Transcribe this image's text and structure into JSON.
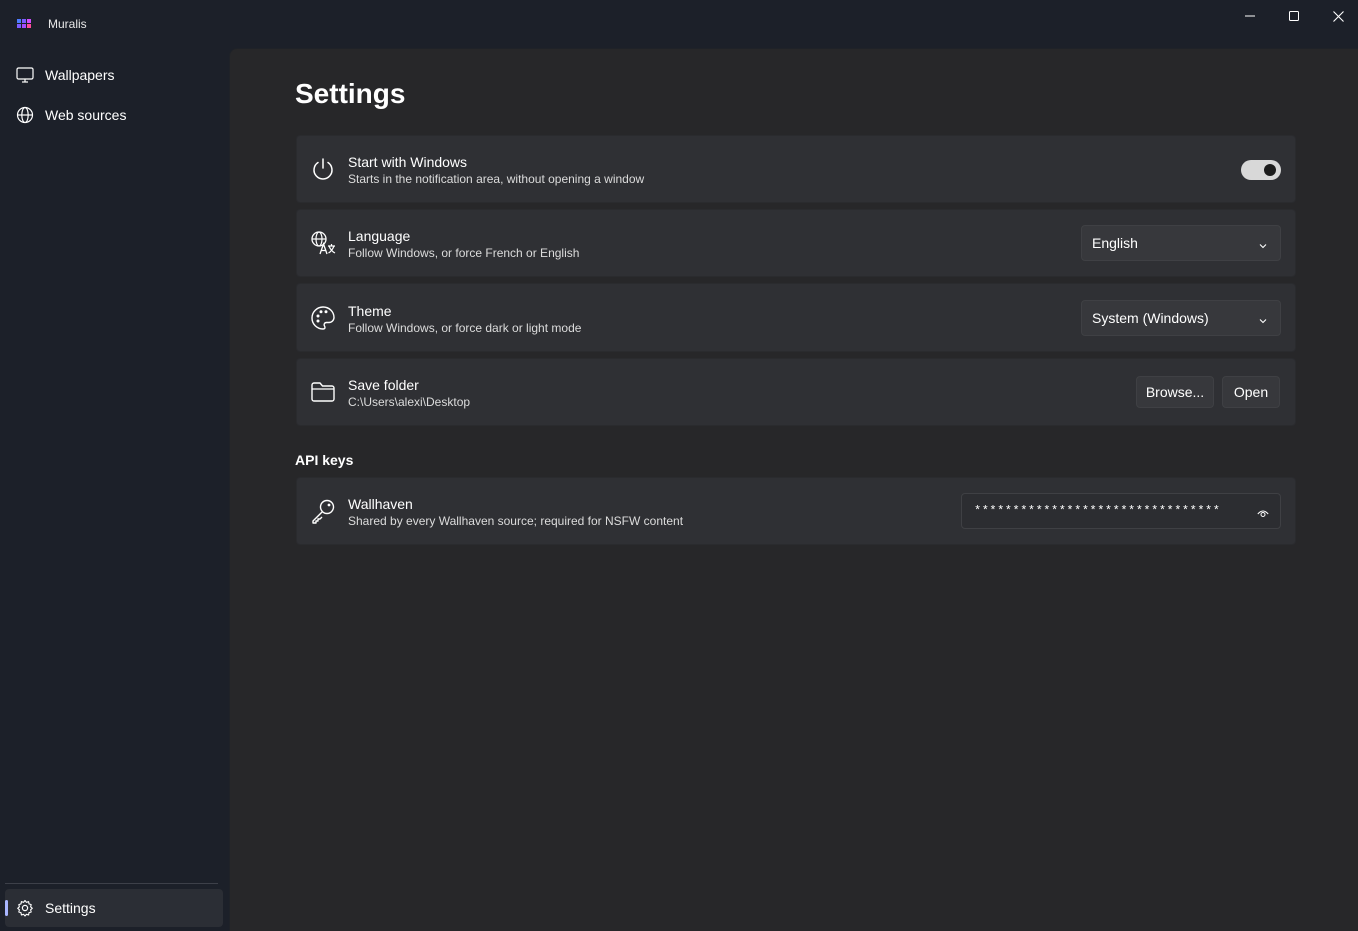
{
  "app": {
    "title": "Muralis"
  },
  "sidebar": {
    "items": [
      {
        "label": "Wallpapers",
        "icon": "monitor-icon"
      },
      {
        "label": "Web sources",
        "icon": "globe-icon"
      }
    ],
    "footer": {
      "label": "Settings",
      "icon": "gear-icon",
      "selected": true
    }
  },
  "page": {
    "title": "Settings"
  },
  "settings": {
    "startup": {
      "title": "Start with Windows",
      "subtitle": "Starts in the notification area, without opening a window",
      "enabled": true,
      "icon": "power-icon"
    },
    "language": {
      "title": "Language",
      "subtitle": "Follow Windows, or force French or English",
      "selected": "English",
      "icon": "language-icon"
    },
    "theme": {
      "title": "Theme",
      "subtitle": "Follow Windows, or force dark or light mode",
      "selected": "System (Windows)",
      "icon": "palette-icon"
    },
    "save_folder": {
      "title": "Save folder",
      "path": "C:\\Users\\alexi\\Desktop",
      "browse_label": "Browse...",
      "open_label": "Open",
      "icon": "folder-icon"
    }
  },
  "api_keys": {
    "header": "API keys",
    "wallhaven": {
      "title": "Wallhaven",
      "subtitle": "Shared by every Wallhaven source; required for NSFW content",
      "masked_value": "********************************",
      "icon": "key-icon"
    }
  },
  "colors": {
    "accent": "#a9b6ff",
    "content_bg": "#272729",
    "card_bg": "#2f3034",
    "sidebar_bg": "#1c2029"
  }
}
